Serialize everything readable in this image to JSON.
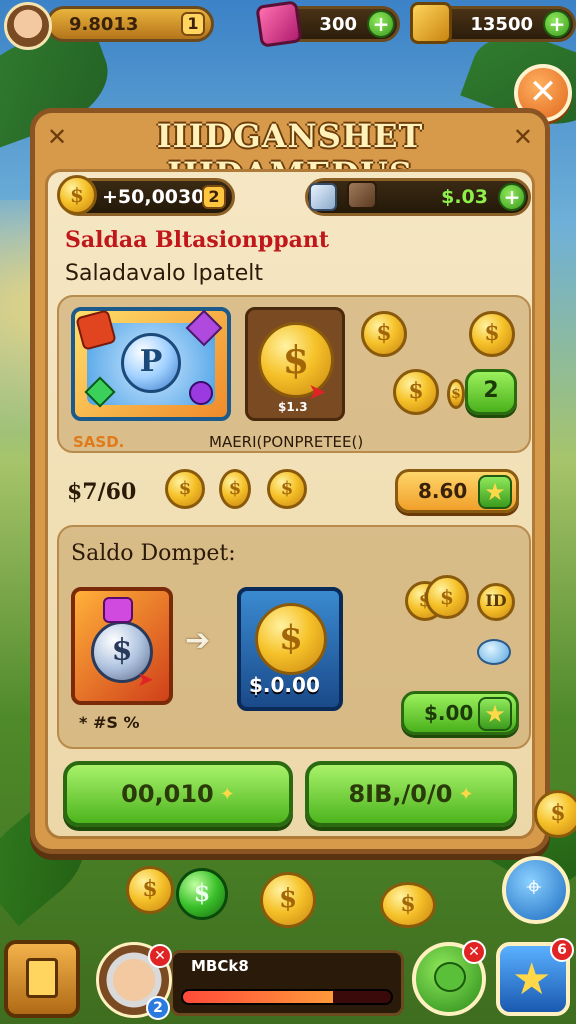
{
  "hud": {
    "coins": "9.8013",
    "level": "1",
    "gems": "300",
    "chest_value": "13500"
  },
  "panel": {
    "title": "IIIDGANSHET IIIDAMEDUS",
    "close_symbol": "✕",
    "corner_left": "✕",
    "corner_right": "✕"
  },
  "wallet": {
    "coins_value": "+50,0030",
    "coins_level": "2",
    "balance_value": "$.03"
  },
  "section1": {
    "heading_red": "Saldaa Bltasionppant",
    "subheading": "Saladavalo lpatelt",
    "card1_label": "SASD.",
    "card2_caption": "$1.3",
    "card2_label": "MAERI(PONPRETEE()",
    "plus_badge": "2",
    "amount": "$7/60",
    "buy_value": "8.60"
  },
  "section2": {
    "heading": "Saldo Dompet:",
    "card_caption": "$.0.00",
    "small_tag": "* #S %",
    "circle_badge": "ID",
    "buy_value": "$.00"
  },
  "actions": {
    "left_label": "00,010",
    "right_label": "8IB,/0/0"
  },
  "bottom": {
    "player_tag": "MBCk8",
    "xp_fraction": 0.72,
    "badge_right": "6",
    "level_badge": "2"
  },
  "colors": {
    "panel_wood": "#d79a4a",
    "panel_border": "#8a5522",
    "accent_green": "#4ab11c",
    "title_red": "#c0171b",
    "coin_gold": "#f6c22a"
  },
  "icons": [
    "avatar",
    "gem-chest-icon",
    "treasure-chest-icon",
    "plus-icon",
    "close-icon",
    "coin-icon",
    "dice-icon",
    "cursor-icon",
    "arrow-right-icon",
    "star-icon",
    "book-icon",
    "pin-icon",
    "piggy-icon"
  ]
}
